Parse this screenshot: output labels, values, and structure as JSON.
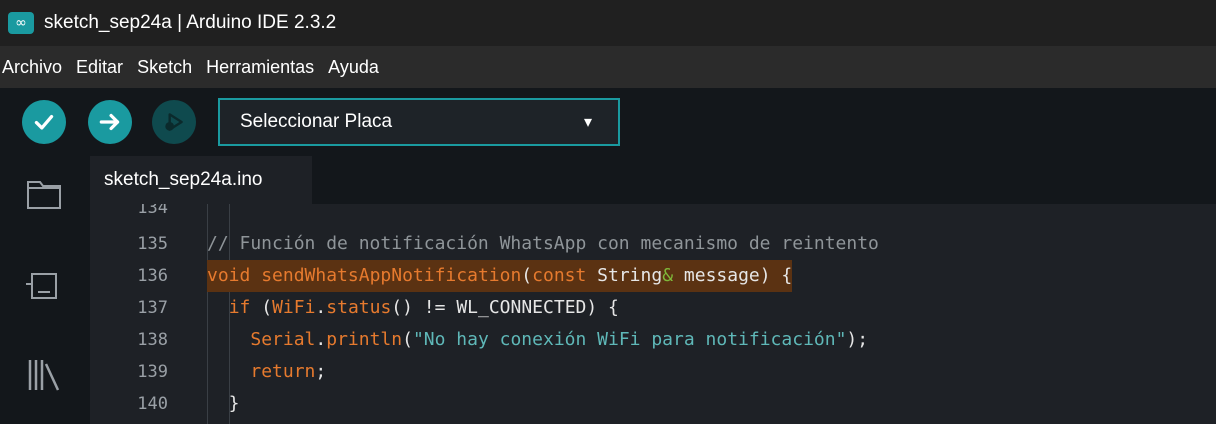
{
  "window": {
    "title": "sketch_sep24a | Arduino IDE 2.3.2",
    "logo_glyph": "∞"
  },
  "menu": [
    "Archivo",
    "Editar",
    "Sketch",
    "Herramientas",
    "Ayuda"
  ],
  "toolbar": {
    "verify_icon": "checkmark-icon",
    "upload_icon": "arrow-right-icon",
    "debug_icon": "debug-icon",
    "board_select_label": "Seleccionar Placa",
    "board_select_arrow": "▾"
  },
  "sidebar": {
    "items": [
      "folder-icon",
      "board-manager-icon",
      "library-icon"
    ]
  },
  "tabs": [
    {
      "label": "sketch_sep24a.ino"
    }
  ],
  "editor": {
    "lines": [
      {
        "num": "134",
        "code": ""
      },
      {
        "num": "135",
        "code": "// Función de notificación WhatsApp con mecanismo de reintento"
      },
      {
        "num": "136",
        "code": "void sendWhatsAppNotification(const String& message) {"
      },
      {
        "num": "137",
        "code": "  if (WiFi.status() != WL_CONNECTED) {"
      },
      {
        "num": "138",
        "code": "    Serial.println(\"No hay conexión WiFi para notificación\");"
      },
      {
        "num": "139",
        "code": "    return;"
      },
      {
        "num": "140",
        "code": "  }"
      }
    ]
  },
  "colors": {
    "accent": "#1a9aa0",
    "keyword": "#e67a2e",
    "string": "#5fb8b8",
    "highlight": "#5b3212",
    "comment": "#8f9599"
  }
}
